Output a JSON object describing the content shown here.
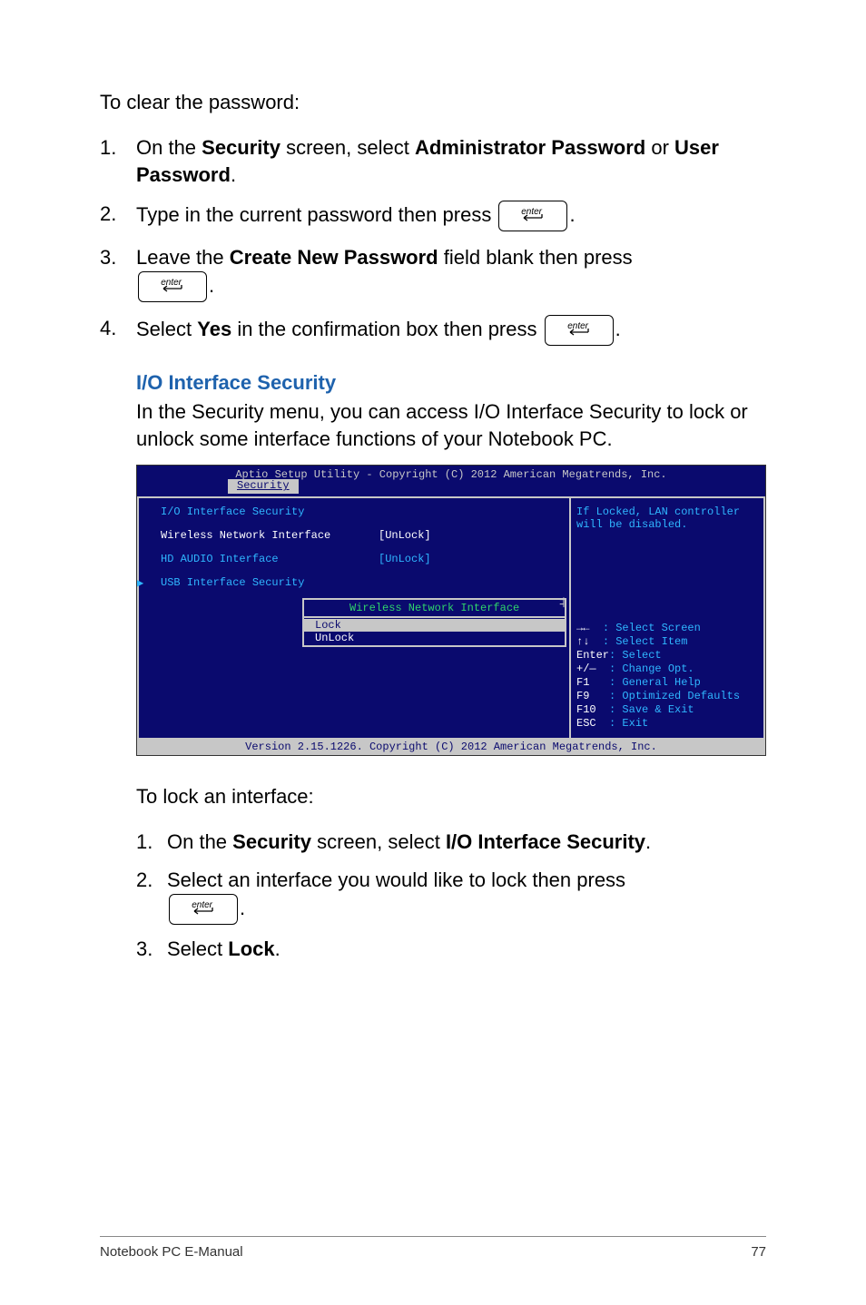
{
  "clear_password": {
    "intro": "To clear the password:",
    "steps": [
      {
        "num": "1.",
        "pre": "On the ",
        "b1": "Security",
        "mid": " screen, select ",
        "b2": "Administrator Password",
        "mid2": " or ",
        "b3": "User Password",
        "post": "."
      },
      {
        "num": "2.",
        "text": "Type in the current password then press "
      },
      {
        "num": "3.",
        "pre": "Leave the ",
        "b1": "Create New Password",
        "post": " field blank then press "
      },
      {
        "num": "4.",
        "pre": "Select ",
        "b1": "Yes",
        "post": " in the confirmation box then press "
      }
    ]
  },
  "io_section": {
    "title": "I/O Interface Security",
    "desc": "In the Security menu, you can access I/O Interface Security to lock or unlock some interface functions of your Notebook PC."
  },
  "bios": {
    "header_title": "Aptio Setup Utility - Copyright (C) 2012 American Megatrends, Inc.",
    "tab": "Security",
    "heading": "I/O Interface Security",
    "rows": [
      {
        "label": "Wireless Network Interface",
        "value": "[UnLock]",
        "style": "white"
      },
      {
        "label": "HD AUDIO Interface",
        "value": "[UnLock]",
        "style": "blue"
      },
      {
        "label": "USB Interface Security",
        "value": "",
        "style": "blue",
        "caret": true
      }
    ],
    "popup": {
      "title": "Wireless Network Interface",
      "options": [
        "Lock",
        "UnLock"
      ],
      "selected": 0
    },
    "right_top1": "If Locked, LAN controller",
    "right_top2": "will be disabled.",
    "help": [
      {
        "k": "→←",
        "v": ": Select Screen"
      },
      {
        "k": "↑↓",
        "v": ": Select Item"
      },
      {
        "k": "Enter",
        "v": ": Select"
      },
      {
        "k": "+/—",
        "v": ": Change Opt."
      },
      {
        "k": "F1",
        "v": ": General Help"
      },
      {
        "k": "F9",
        "v": ": Optimized Defaults"
      },
      {
        "k": "F10",
        "v": ": Save & Exit"
      },
      {
        "k": "ESC",
        "v": ": Exit"
      }
    ],
    "footer": "Version 2.15.1226. Copyright (C) 2012 American Megatrends, Inc."
  },
  "lock_iface": {
    "intro": "To lock an interface:",
    "steps": [
      {
        "num": "1.",
        "pre": "On the ",
        "b1": "Security",
        "mid": " screen, select ",
        "b2": "I/O Interface Security",
        "post": "."
      },
      {
        "num": "2.",
        "text": "Select an interface you would like to lock then press "
      },
      {
        "num": "3.",
        "pre": "Select ",
        "b1": "Lock",
        "post": "."
      }
    ]
  },
  "footer": {
    "left": "Notebook PC E-Manual",
    "right": "77"
  },
  "key_label": "enter"
}
